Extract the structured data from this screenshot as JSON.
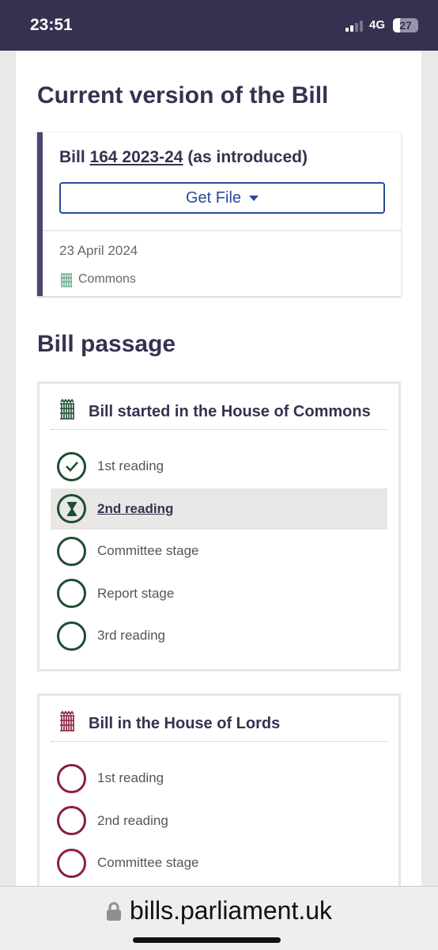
{
  "status_bar": {
    "time": "23:51",
    "network": "4G",
    "battery": "27",
    "battery_level": 27
  },
  "current_version": {
    "heading": "Current version of the Bill",
    "bill_prefix": "Bill",
    "bill_number": "164 2023-24",
    "bill_suffix": "(as introduced)",
    "get_file_label": "Get File",
    "date": "23 April 2024",
    "house": "Commons"
  },
  "passage": {
    "heading": "Bill passage",
    "commons": {
      "title": "Bill started in the House of Commons",
      "color": "#1e4d30",
      "stages": [
        {
          "label": "1st reading",
          "status": "complete"
        },
        {
          "label": "2nd reading",
          "status": "current"
        },
        {
          "label": "Committee stage",
          "status": "pending"
        },
        {
          "label": "Report stage",
          "status": "pending"
        },
        {
          "label": "3rd reading",
          "status": "pending"
        }
      ]
    },
    "lords": {
      "title": "Bill in the House of Lords",
      "color": "#8a1f3a",
      "stages": [
        {
          "label": "1st reading",
          "status": "pending"
        },
        {
          "label": "2nd reading",
          "status": "pending"
        },
        {
          "label": "Committee stage",
          "status": "pending"
        }
      ]
    }
  },
  "browser": {
    "url": "bills.parliament.uk"
  }
}
